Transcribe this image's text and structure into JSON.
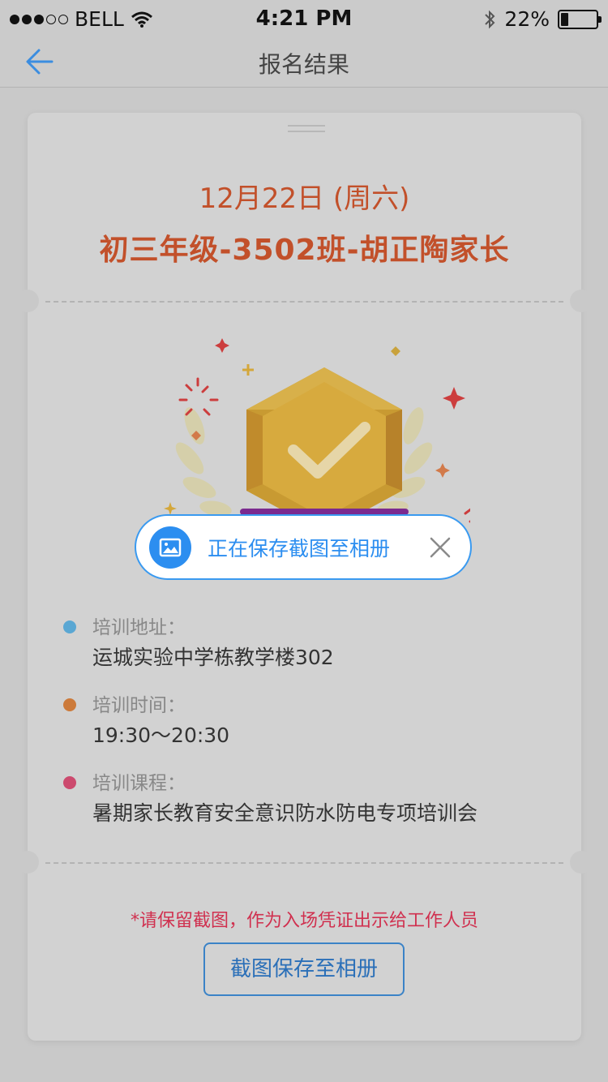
{
  "status_bar": {
    "carrier": "BELL",
    "time": "4:21 PM",
    "battery_pct": "22%",
    "battery_level": 0.22
  },
  "nav": {
    "title": "报名结果",
    "back_icon": "back-arrow-icon"
  },
  "card": {
    "date": "12月22日 (周六)",
    "class_title": "初三年级-3502班-胡正陶家长",
    "info": [
      {
        "label": "培训地址：",
        "value": "运城实验中学栋教学楼302",
        "color": "#5aa7d3"
      },
      {
        "label": "培训时间：",
        "value": "19:30～20:30",
        "color": "#cc7a3a"
      },
      {
        "label": "培训课程：",
        "value": "暑期家长教育安全意识防水防电专项培训会",
        "color": "#cc4a6e"
      }
    ],
    "notice": "*请保留截图，作为入场凭证出示给工作人员",
    "save_button": "截图保存至相册"
  },
  "toast": {
    "text": "正在保存截图至相册",
    "icon": "image-icon",
    "close_icon": "close-icon"
  },
  "colors": {
    "accent": "#2c8ef0",
    "title": "#c2502a",
    "notice": "#d0304f"
  }
}
